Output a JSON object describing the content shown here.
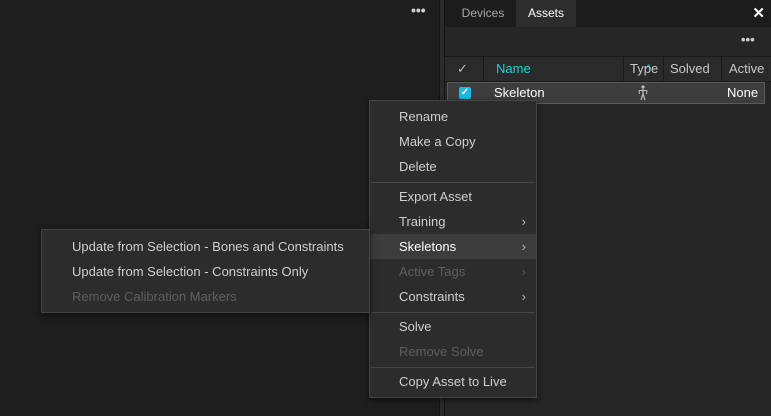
{
  "viewport": {
    "more_icon": "•••"
  },
  "panel": {
    "tabs": [
      {
        "label": "Devices",
        "active": false
      },
      {
        "label": "Assets",
        "active": true
      }
    ],
    "close_icon": "✕",
    "more_icon": "•••"
  },
  "table": {
    "columns": {
      "check": "✓",
      "name": "Name",
      "name_sort": "^",
      "type": "Type",
      "solved": "Solved",
      "active": "Active"
    },
    "rows": [
      {
        "checked": true,
        "name": "Skeleton",
        "type_icon": "skeleton-figure-icon",
        "solved": "",
        "active": "None"
      }
    ]
  },
  "context_menu": {
    "items": [
      {
        "label": "Rename",
        "enabled": true
      },
      {
        "label": "Make a Copy",
        "enabled": true
      },
      {
        "label": "Delete",
        "enabled": true
      },
      {
        "label": "Export Asset",
        "enabled": true
      },
      {
        "label": "Training",
        "enabled": true,
        "submenu": true
      },
      {
        "label": "Skeletons",
        "enabled": true,
        "submenu": true,
        "highlighted": true
      },
      {
        "label": "Active Tags",
        "enabled": false,
        "submenu": true
      },
      {
        "label": "Constraints",
        "enabled": true,
        "submenu": true
      },
      {
        "label": "Solve",
        "enabled": true
      },
      {
        "label": "Remove Solve",
        "enabled": false
      },
      {
        "label": "Copy Asset to Live",
        "enabled": true
      }
    ],
    "chevron": "›"
  },
  "skeletons_submenu": {
    "items": [
      {
        "label": "Update from Selection - Bones and Constraints",
        "enabled": true
      },
      {
        "label": "Update from Selection - Constraints Only",
        "enabled": true
      },
      {
        "label": "Remove Calibration Markers",
        "enabled": false
      }
    ]
  },
  "colors": {
    "accent": "#19d3e0",
    "checkbox": "#19b8e8",
    "background": "#1f1f1f"
  }
}
